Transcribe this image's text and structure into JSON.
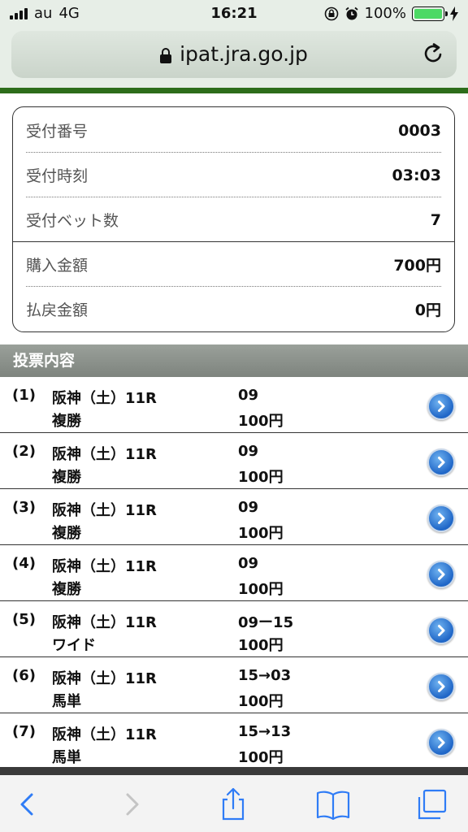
{
  "status_bar": {
    "carrier": "au",
    "network": "4G",
    "time": "16:21",
    "battery": "100%",
    "battery_level": 1.0
  },
  "browser": {
    "url": "ipat.jra.go.jp"
  },
  "summary": {
    "rows": [
      {
        "label": "受付番号",
        "value": "0003"
      },
      {
        "label": "受付時刻",
        "value": "03:03"
      },
      {
        "label": "受付ベット数",
        "value": "7"
      },
      {
        "label": "購入金額",
        "value": "700円"
      },
      {
        "label": "払戻金額",
        "value": "0円"
      }
    ]
  },
  "section": {
    "title": "投票内容"
  },
  "bets": [
    {
      "index": "(1)",
      "race": "阪神（土）11R",
      "type": "複勝",
      "combo": "09",
      "amount": "100円"
    },
    {
      "index": "(2)",
      "race": "阪神（土）11R",
      "type": "複勝",
      "combo": "09",
      "amount": "100円"
    },
    {
      "index": "(3)",
      "race": "阪神（土）11R",
      "type": "複勝",
      "combo": "09",
      "amount": "100円"
    },
    {
      "index": "(4)",
      "race": "阪神（土）11R",
      "type": "複勝",
      "combo": "09",
      "amount": "100円"
    },
    {
      "index": "(5)",
      "race": "阪神（土）11R",
      "type": "ワイド",
      "combo": "09ー15",
      "amount": "100円"
    },
    {
      "index": "(6)",
      "race": "阪神（土）11R",
      "type": "馬単",
      "combo": "15→03",
      "amount": "100円"
    },
    {
      "index": "(7)",
      "race": "阪神（土）11R",
      "type": "馬単",
      "combo": "15→13",
      "amount": "100円"
    }
  ],
  "colors": {
    "header_green": "#2d6d1b",
    "section_gray": "#8a908a",
    "chevron_blue": "#1f66c7",
    "toolbar_blue": "#2f7cf6"
  }
}
